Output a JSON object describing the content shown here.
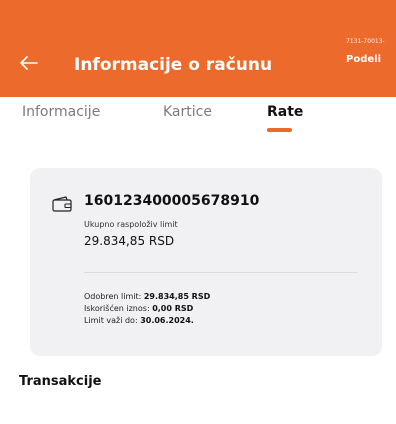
{
  "header": {
    "title": "Informacije o računu",
    "account_small": "7131-70013-",
    "share_label": "Podeli",
    "back_icon": "arrow-left-icon",
    "background_color": "#ec6a2b"
  },
  "tabs": [
    {
      "label": "Informacije",
      "active": false
    },
    {
      "label": "Kartice",
      "active": false
    },
    {
      "label": "Rate",
      "active": true
    }
  ],
  "card": {
    "icon": "wallet-icon",
    "account_number": "160123400005678910",
    "available_limit_label": "Ukupno raspoloživ limit",
    "available_limit_value": "29.834,85 RSD",
    "approved_label": "Odobren limit:",
    "approved_value": "29.834,85 RSD",
    "used_label": "Iskorišćen iznos:",
    "used_value": "0,00 RSD",
    "valid_label": "Limit važi do:",
    "valid_value": "30.06.2024."
  },
  "transactions_title": "Transakcije"
}
